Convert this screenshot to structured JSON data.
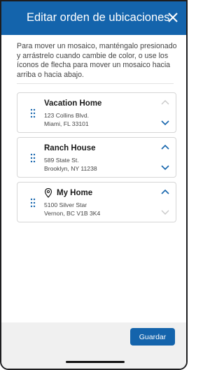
{
  "header": {
    "title": "Editar orden de ubicaciones",
    "close_icon": "close-icon"
  },
  "instructions": "Para mover un mosaico, manténgalo presionado y arrástrelo cuando cambie de color, o use los íconos de flecha para mover un mosaico hacia arriba o hacia abajo.",
  "locations": [
    {
      "name": "Vacation Home",
      "address_line1": "123 Collins Blvd.",
      "address_line2": "Miami, FL 33101",
      "has_pin": false,
      "up_enabled": false,
      "down_enabled": true
    },
    {
      "name": "Ranch House",
      "address_line1": "589 State St.",
      "address_line2": "Brooklyn, NY 11238",
      "has_pin": false,
      "up_enabled": true,
      "down_enabled": true
    },
    {
      "name": "My Home",
      "address_line1": "5100 Silver Star",
      "address_line2": "Vernon, BC V1B 3K4",
      "has_pin": true,
      "up_enabled": true,
      "down_enabled": false
    }
  ],
  "footer": {
    "save_label": "Guardar"
  },
  "colors": {
    "brand": "#1464ac",
    "disabled": "#c8c8c8",
    "footer_bg": "#f0f0f0"
  }
}
